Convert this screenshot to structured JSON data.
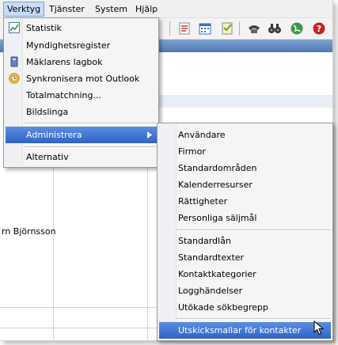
{
  "menubar": {
    "items": [
      {
        "label": "Verktyg"
      },
      {
        "label": "Tjänster"
      },
      {
        "label": "System"
      },
      {
        "label": "Hjälp"
      }
    ]
  },
  "toolbar": {
    "icons": [
      "note-icon",
      "calendar-icon",
      "checklist-icon",
      "phone-icon",
      "binoculars-icon",
      "globe-icon",
      "help-icon"
    ],
    "colors": {
      "note": "#d23c2c",
      "calendar": "#3a6fc9",
      "checklist": "#6fa12a",
      "help": "#cc2020"
    }
  },
  "grid": {
    "partial_name": "rn Björnsson"
  },
  "main_menu": {
    "items": [
      {
        "label": "Statistik",
        "icon": "chart-icon"
      },
      {
        "label": "Myndighetsregister",
        "icon": ""
      },
      {
        "label": "Mäklarens lagbok",
        "icon": "book-icon"
      },
      {
        "label": "Synkronisera mot Outlook",
        "icon": "outlook-sync-icon"
      },
      {
        "label": "Totalmatchning...",
        "icon": ""
      },
      {
        "label": "Bildslinga",
        "icon": ""
      }
    ],
    "administrera": "Administrera",
    "alternativ": "Alternativ"
  },
  "submenu": {
    "group1": [
      "Användare",
      "Firmor",
      "Standardområden",
      "Kalenderresurser",
      "Rättigheter",
      "Personliga säljmål"
    ],
    "group2": [
      "Standardlån",
      "Standardtexter",
      "Kontaktkategorier",
      "Logghändelser",
      "Utökade sökbegrepp"
    ],
    "highlighted": "Utskicksmallar för kontakter"
  },
  "colors": {
    "highlight": "#3a6fd0",
    "menu_bg": "#f5f5f5",
    "header_blue": "#5a82bd"
  }
}
